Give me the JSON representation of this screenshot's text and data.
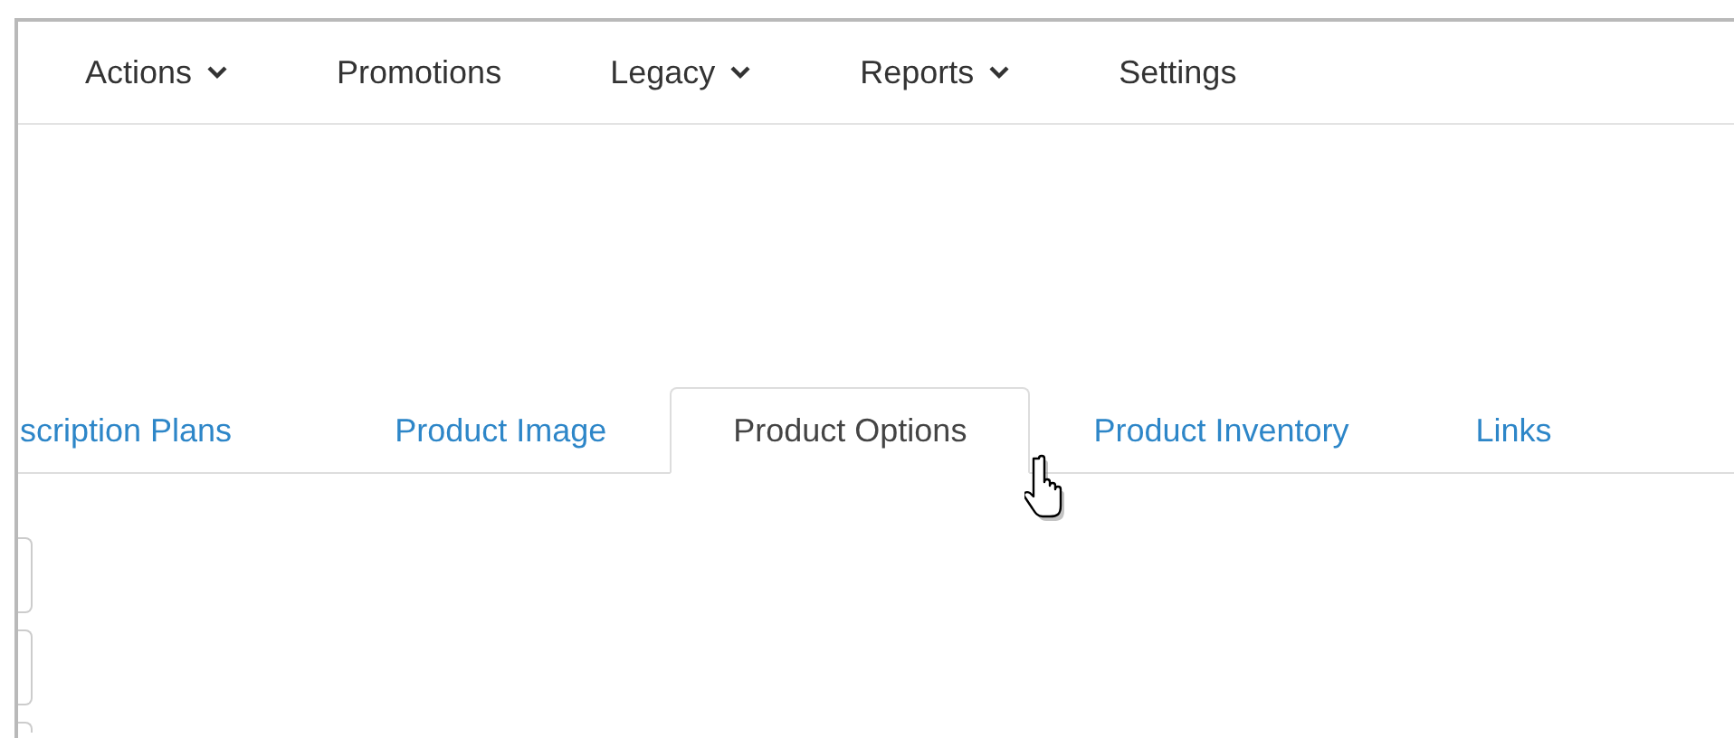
{
  "nav": [
    {
      "label": "Actions",
      "dropdown": true
    },
    {
      "label": "Promotions",
      "dropdown": false
    },
    {
      "label": "Legacy",
      "dropdown": true
    },
    {
      "label": "Reports",
      "dropdown": true
    },
    {
      "label": "Settings",
      "dropdown": false
    }
  ],
  "tabs": [
    {
      "label": "scription Plans",
      "selected": false
    },
    {
      "label": "Product Image",
      "selected": false
    },
    {
      "label": "Product Options",
      "selected": true
    },
    {
      "label": "Product Inventory",
      "selected": false
    },
    {
      "label": "Links",
      "selected": false
    }
  ]
}
